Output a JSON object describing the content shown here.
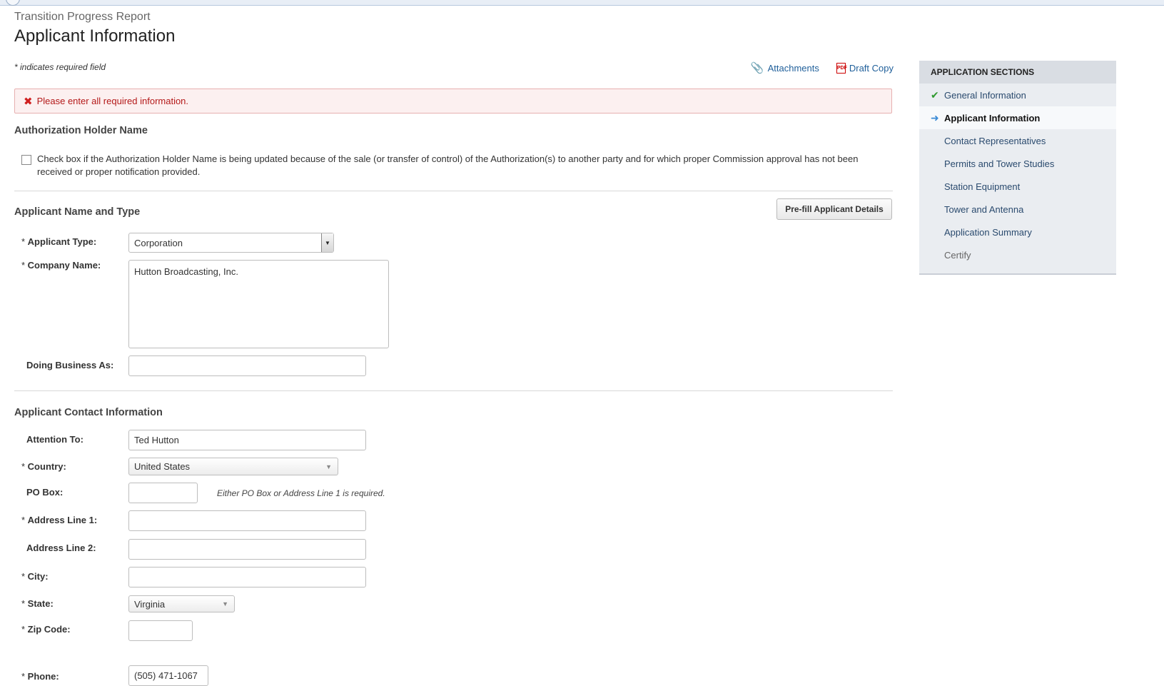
{
  "header": {
    "subtitle": "Transition Progress Report",
    "title": "Applicant Information",
    "required_note": "* indicates required field",
    "links": {
      "attachments": "Attachments",
      "draft_copy": "Draft Copy"
    }
  },
  "error_message": "Please enter all required information.",
  "auth_holder": {
    "heading": "Authorization Holder Name",
    "checkbox_label": "Check box if the Authorization Holder Name is being updated because of the sale (or transfer of control) of the Authorization(s) to another party and for which proper Commission approval has not been received or proper notification provided.",
    "checked": false
  },
  "applicant": {
    "heading": "Applicant Name and Type",
    "prefill_button": "Pre-fill Applicant Details",
    "type_label": "Applicant Type:",
    "type_value": "Corporation",
    "company_label": "Company Name:",
    "company_value": "Hutton Broadcasting, Inc.",
    "dba_label": "Doing Business As:",
    "dba_value": ""
  },
  "contact": {
    "heading": "Applicant Contact Information",
    "attention_label": "Attention To:",
    "attention_value": "Ted Hutton",
    "country_label": "Country:",
    "country_value": "United States",
    "pobox_label": "PO Box:",
    "pobox_value": "",
    "pobox_hint": "Either PO Box or Address Line 1 is required.",
    "address1_label": "Address Line 1:",
    "address1_value": "",
    "address2_label": "Address Line 2:",
    "address2_value": "",
    "city_label": "City:",
    "city_value": "",
    "state_label": "State:",
    "state_value": "Virginia",
    "zip_label": "Zip Code:",
    "zip_value": "",
    "phone_label": "Phone:",
    "phone_value": "(505) 471-1067"
  },
  "sidebar": {
    "heading": "APPLICATION SECTIONS",
    "items": [
      {
        "label": "General Information",
        "state": "complete"
      },
      {
        "label": "Applicant Information",
        "state": "current"
      },
      {
        "label": "Contact Representatives",
        "state": "pending"
      },
      {
        "label": "Permits and Tower Studies",
        "state": "pending"
      },
      {
        "label": "Station Equipment",
        "state": "pending"
      },
      {
        "label": "Tower and Antenna",
        "state": "pending"
      },
      {
        "label": "Application Summary",
        "state": "pending"
      },
      {
        "label": "Certify",
        "state": "disabled"
      }
    ]
  },
  "colors": {
    "link": "#1f5f9a",
    "error": "#b41919",
    "sidebar_bg": "#eaedf1",
    "check": "#2f9a2f",
    "arrow": "#3a8ad6"
  }
}
